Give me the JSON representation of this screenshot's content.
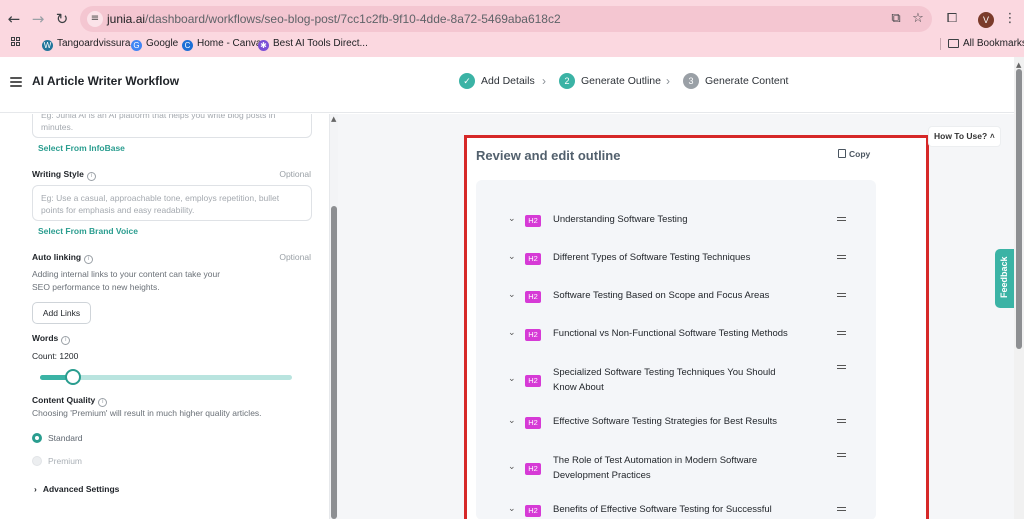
{
  "browser": {
    "url_host": "junia.ai",
    "url_path": "/dashboard/workflows/seo-blog-post/7cc1c2fb-9f10-4dde-8a72-5469aba618c2",
    "profile_initial": "V",
    "bookmarks": [
      {
        "label": "Tangoardvissura -",
        "color": "#21759b",
        "glyph": "W"
      },
      {
        "label": "Google",
        "color": "#4285f4",
        "glyph": "G"
      },
      {
        "label": "Home - Canva",
        "color": "#1d6fd6",
        "glyph": "C"
      },
      {
        "label": "Best AI Tools Direct...",
        "color": "#7b4fd6",
        "glyph": "✱"
      }
    ],
    "all_bookmarks": "All Bookmarks"
  },
  "header": {
    "title": "AI Article Writer Workflow",
    "steps": [
      {
        "label": "Add Details",
        "badge": "✓",
        "state": "done",
        "color": "#3bb3a5"
      },
      {
        "label": "Generate Outline",
        "badge": "2",
        "state": "active",
        "color": "#3bb3a5"
      },
      {
        "label": "Generate Content",
        "badge": "3",
        "state": "todo",
        "color": "#9aa0a6"
      }
    ]
  },
  "sidebar": {
    "description_placeholder": "Eg: Junia AI is an AI platform that helps you write blog posts in minutes.",
    "select_infobase": "Select From InfoBase",
    "writing_style": {
      "label": "Writing Style",
      "optional": "Optional",
      "placeholder": "Eg: Use a casual, approachable tone, employs repetition, bullet points for emphasis and easy readability."
    },
    "select_brand_voice": "Select From Brand Voice",
    "auto_linking": {
      "label": "Auto linking",
      "optional": "Optional",
      "help_line1": "Adding internal links to your content can take your",
      "help_line2": "SEO performance to new heights.",
      "button": "Add Links"
    },
    "words": {
      "label": "Words",
      "count_label": "Count: 1200",
      "slider_fraction": 0.13
    },
    "content_quality": {
      "label": "Content Quality",
      "help": "Choosing 'Premium' will result in much higher quality articles.",
      "options": [
        {
          "label": "Standard",
          "selected": true
        },
        {
          "label": "Premium",
          "selected": false
        }
      ]
    },
    "advanced_settings": "Advanced Settings"
  },
  "main": {
    "card_title": "Review and edit outline",
    "copy_label": "Copy",
    "how_to_use": "How To Use?",
    "feedback": "Feedback",
    "heading_tag": "H2",
    "outline": [
      [
        "Understanding Software Testing"
      ],
      [
        "Different Types of Software Testing Techniques"
      ],
      [
        "Software Testing Based on Scope and Focus Areas"
      ],
      [
        "Functional vs Non-Functional Software Testing Methods"
      ],
      [
        "Specialized Software Testing Techniques You Should",
        "Know About"
      ],
      [
        "Effective Software Testing Strategies for Best Results"
      ],
      [
        "The Role of Test Automation in Modern Software",
        "Development Practices"
      ],
      [
        "Benefits of Effective Software Testing for Successful"
      ]
    ]
  },
  "colors": {
    "accent_teal": "#3bb3a5",
    "heading_tag": "#d63ad6",
    "highlight_box": "#d62828"
  }
}
